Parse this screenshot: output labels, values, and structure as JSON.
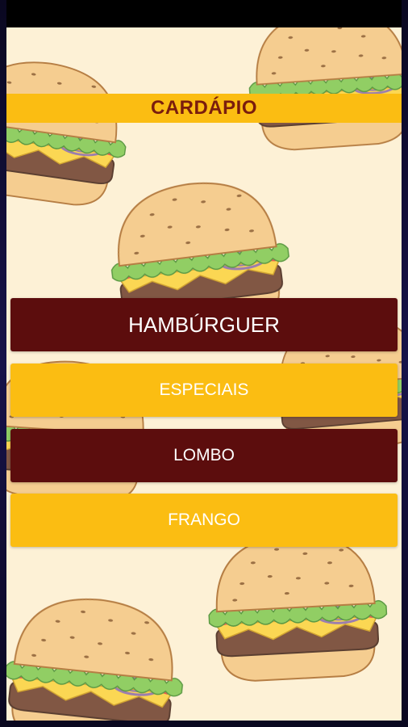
{
  "header": {
    "title": "CARDÁPIO"
  },
  "menu": [
    {
      "label": "HAMBÚRGUER"
    },
    {
      "label": "ESPECIAIS"
    },
    {
      "label": "LOMBO"
    },
    {
      "label": "FRANGO"
    }
  ],
  "colors": {
    "background": "#fdf1d6",
    "accent_yellow": "#fbbd12",
    "dark_red": "#5c0d0d",
    "title_text": "#7a1d0d"
  },
  "decor": {
    "illustration": "burger-icon"
  }
}
